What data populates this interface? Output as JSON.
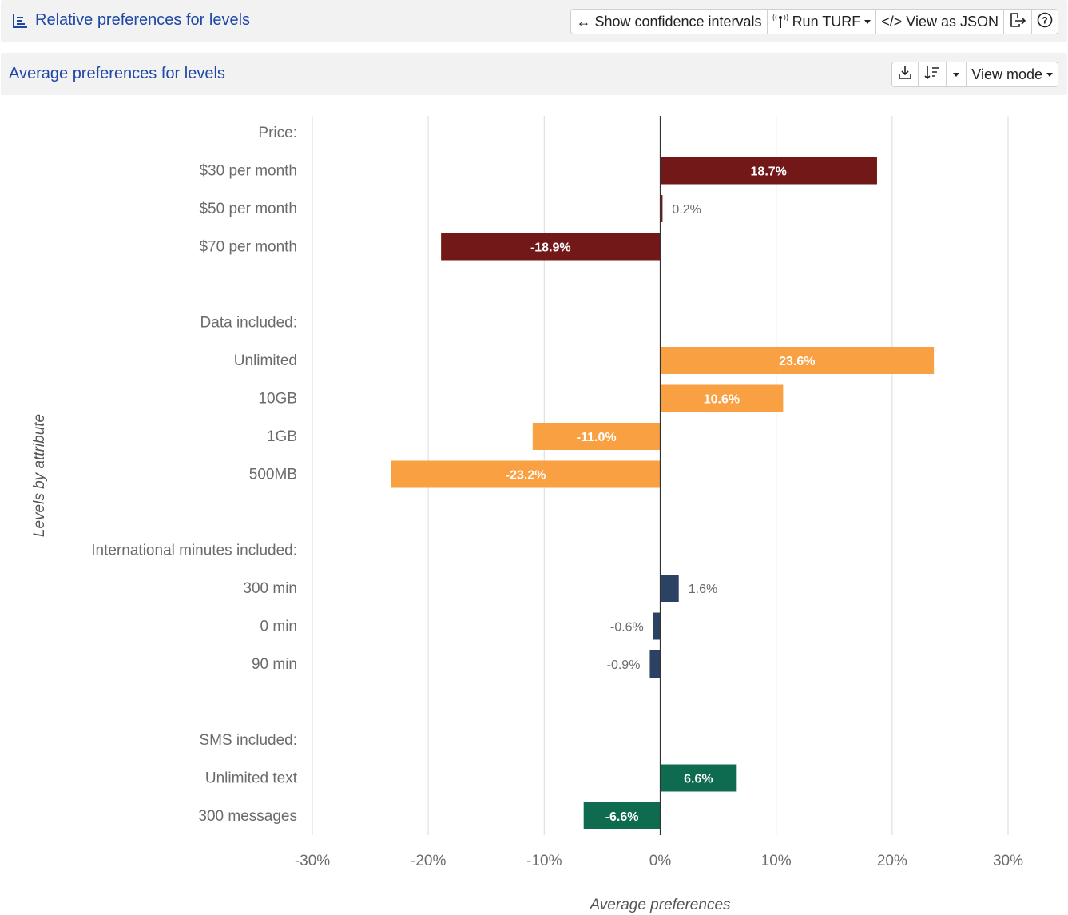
{
  "header": {
    "title": "Relative preferences for levels",
    "title_icon": "bar-chart-icon",
    "toolbar": {
      "show_ci_label": "Show confidence intervals",
      "run_turf_label": "Run TURF",
      "view_json_label": "View as JSON",
      "export_icon": "export-icon",
      "help_icon": "help-icon"
    }
  },
  "subheader": {
    "title": "Average preferences for levels",
    "toolbar": {
      "download_icon": "download-icon",
      "sort_icon": "sort-icon",
      "view_mode_label": "View mode"
    }
  },
  "colors": {
    "Price": "#721818",
    "Data included": "#f9a043",
    "International minutes included": "#2c4263",
    "SMS included": "#0f6b4f"
  },
  "chart_data": {
    "type": "bar",
    "orientation": "horizontal",
    "title": "Average preferences for levels",
    "xlabel": "Average preferences",
    "ylabel": "Levels by attribute",
    "xlim": [
      -30,
      30
    ],
    "x_ticks": [
      "-30%",
      "-20%",
      "-10%",
      "0%",
      "10%",
      "20%",
      "30%"
    ],
    "x_tick_values": [
      -30,
      -20,
      -10,
      0,
      10,
      20,
      30
    ],
    "grid": true,
    "unit": "%",
    "groups": [
      {
        "attribute": "Price",
        "label": "Price:",
        "levels": [
          {
            "label": "$30 per month",
            "value": 18.7
          },
          {
            "label": "$50 per month",
            "value": 0.2
          },
          {
            "label": "$70 per month",
            "value": -18.9
          }
        ]
      },
      {
        "attribute": "Data included",
        "label": "Data included:",
        "levels": [
          {
            "label": "Unlimited",
            "value": 23.6
          },
          {
            "label": "10GB",
            "value": 10.6
          },
          {
            "label": "1GB",
            "value": -11.0
          },
          {
            "label": "500MB",
            "value": -23.2
          }
        ]
      },
      {
        "attribute": "International minutes included",
        "label": "International minutes included:",
        "levels": [
          {
            "label": "300 min",
            "value": 1.6
          },
          {
            "label": "0 min",
            "value": -0.6
          },
          {
            "label": "90 min",
            "value": -0.9
          }
        ]
      },
      {
        "attribute": "SMS included",
        "label": "SMS included:",
        "levels": [
          {
            "label": "Unlimited text",
            "value": 6.6
          },
          {
            "label": "300 messages",
            "value": -6.6
          }
        ]
      }
    ]
  }
}
